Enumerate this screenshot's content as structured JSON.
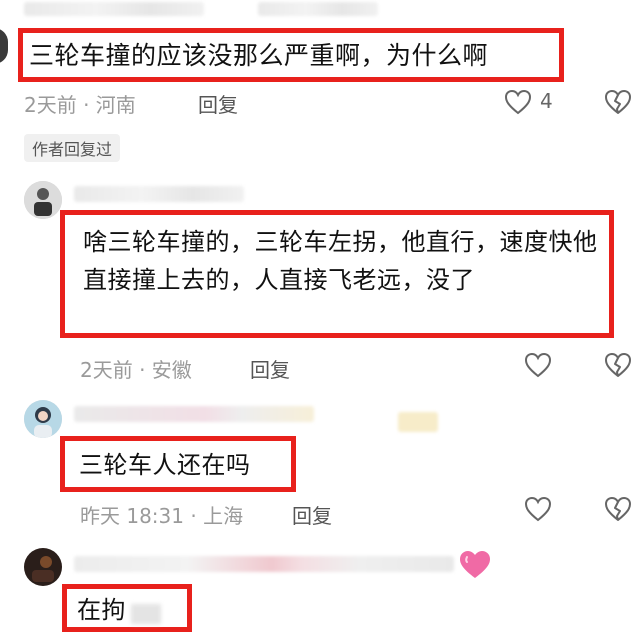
{
  "comments": [
    {
      "text": "三轮车撞的应该没那么严重啊，为什么啊",
      "meta": "2天前 · 河南",
      "reply_label": "回复",
      "like_count": "4",
      "author_tag": "作者回复过"
    },
    {
      "text": "啥三轮车撞的，三轮车左拐，他直行，速度快他直接撞上去的，人直接飞老远，没了",
      "meta": "2天前 · 安徽",
      "reply_label": "回复"
    },
    {
      "text": "三轮车人还在吗",
      "meta": "昨天 18:31 · 上海",
      "reply_label": "回复"
    },
    {
      "text": "在拘",
      "badge_icon": "pink-heart-icon"
    }
  ],
  "colors": {
    "highlight_border": "#e8211c",
    "meta_text": "#9a9a9a"
  }
}
